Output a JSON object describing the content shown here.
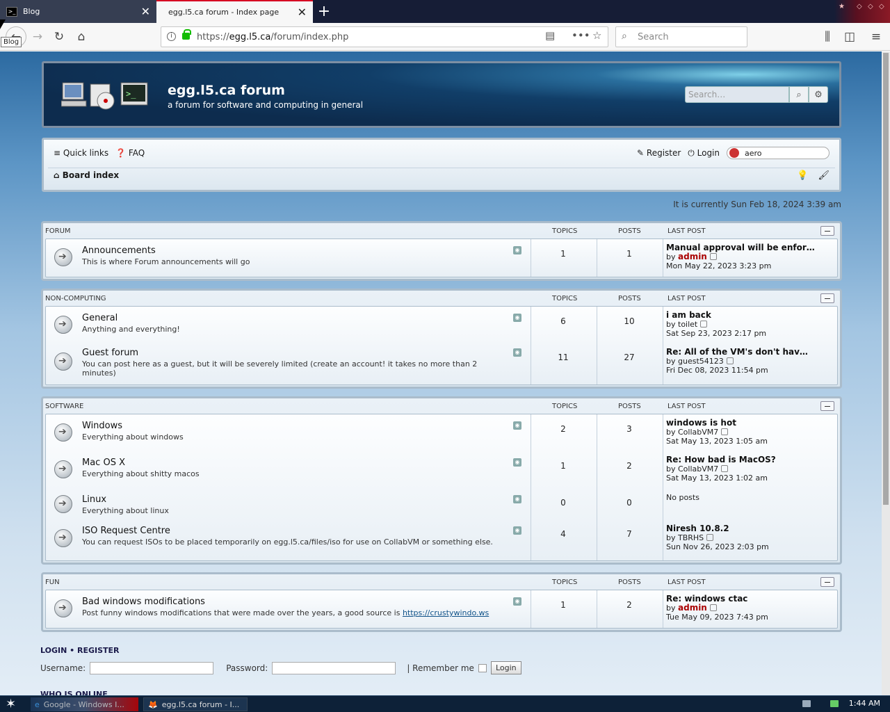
{
  "browser": {
    "tabs": [
      {
        "title": "Blog",
        "favicon": "terminal"
      },
      {
        "title": "egg.l5.ca forum - Index page"
      }
    ],
    "tooltip": "Blog",
    "url_prefix": "https://",
    "url_host": "egg.l5.ca",
    "url_path": "/forum/index.php",
    "search_placeholder": "Search"
  },
  "forum": {
    "site_name": "egg.l5.ca forum",
    "site_description": "a forum for software and computing in general",
    "search_placeholder": "Search…",
    "nav": {
      "quick_links": "Quick links",
      "faq": "FAQ",
      "register": "Register",
      "login": "Login",
      "style_value": "aero",
      "board_index": "Board index"
    },
    "current_time": "It is currently Sun Feb 18, 2024 3:39 am",
    "col_topics": "TOPICS",
    "col_posts": "POSTS",
    "col_last_post": "LAST POST",
    "categories": [
      {
        "name": "FORUM",
        "forums": [
          {
            "name": "Announcements",
            "desc": "This is where Forum announcements will go",
            "topics": "1",
            "posts": "1",
            "last_title": "Manual approval will be enfor…",
            "by_prefix": "by",
            "last_by": "admin",
            "last_by_admin": true,
            "last_time": "Mon May 22, 2023 3:23 pm"
          }
        ]
      },
      {
        "name": "NON-COMPUTING",
        "forums": [
          {
            "name": "General",
            "desc": "Anything and everything!",
            "topics": "6",
            "posts": "10",
            "last_title": "i am back",
            "by_prefix": "by",
            "last_by": "toilet",
            "last_time": "Sat Sep 23, 2023 2:17 pm"
          },
          {
            "name": "Guest forum",
            "desc": "You can post here as a guest, but it will be severely limited (create an account! it takes no more than 2 minutes)",
            "topics": "11",
            "posts": "27",
            "last_title": "Re: All of the VM's don't hav…",
            "by_prefix": "by",
            "last_by": "guest54123",
            "last_time": "Fri Dec 08, 2023 11:54 pm"
          }
        ]
      },
      {
        "name": "SOFTWARE",
        "forums": [
          {
            "name": "Windows",
            "desc": "Everything about windows",
            "topics": "2",
            "posts": "3",
            "last_title": "windows is hot",
            "by_prefix": "by",
            "last_by": "CollabVM7",
            "last_time": "Sat May 13, 2023 1:05 am"
          },
          {
            "name": "Mac OS X",
            "desc": "Everything about shitty macos",
            "topics": "1",
            "posts": "2",
            "last_title": "Re: How bad is MacOS?",
            "by_prefix": "by",
            "last_by": "CollabVM7",
            "last_time": "Sat May 13, 2023 1:02 am"
          },
          {
            "name": "Linux",
            "desc": "Everything about linux",
            "topics": "0",
            "posts": "0",
            "no_posts": "No posts"
          },
          {
            "name": "ISO Request Centre",
            "desc": "You can request ISOs to be placed temporarily on egg.l5.ca/files/iso for use on CollabVM or something else.",
            "topics": "4",
            "posts": "7",
            "last_title": "Niresh 10.8.2",
            "by_prefix": "by",
            "last_by": "TBRHS",
            "last_time": "Sun Nov 26, 2023 2:03 pm"
          }
        ]
      },
      {
        "name": "FUN",
        "forums": [
          {
            "name": "Bad windows modifications",
            "desc": "Post funny windows modifications that were made over the years, a good source is",
            "desc_link": "https://crustywindo.ws",
            "topics": "1",
            "posts": "2",
            "last_title": "Re: windows ctac",
            "by_prefix": "by",
            "last_by": "admin",
            "last_by_admin": true,
            "last_time": "Tue May 09, 2023 7:43 pm"
          }
        ]
      }
    ],
    "login": {
      "heading_login": "LOGIN",
      "heading_sep": "•",
      "heading_register": "REGISTER",
      "username_label": "Username:",
      "password_label": "Password:",
      "remember_label": "| Remember me",
      "button": "Login"
    },
    "who_online": "WHO IS ONLINE"
  },
  "taskbar": {
    "items": [
      "Google - Windows I...",
      "egg.l5.ca forum - I..."
    ],
    "clock": "1:44 AM"
  },
  "colors": {
    "admin": "#aa0000",
    "accent_tab": "#d70022"
  }
}
